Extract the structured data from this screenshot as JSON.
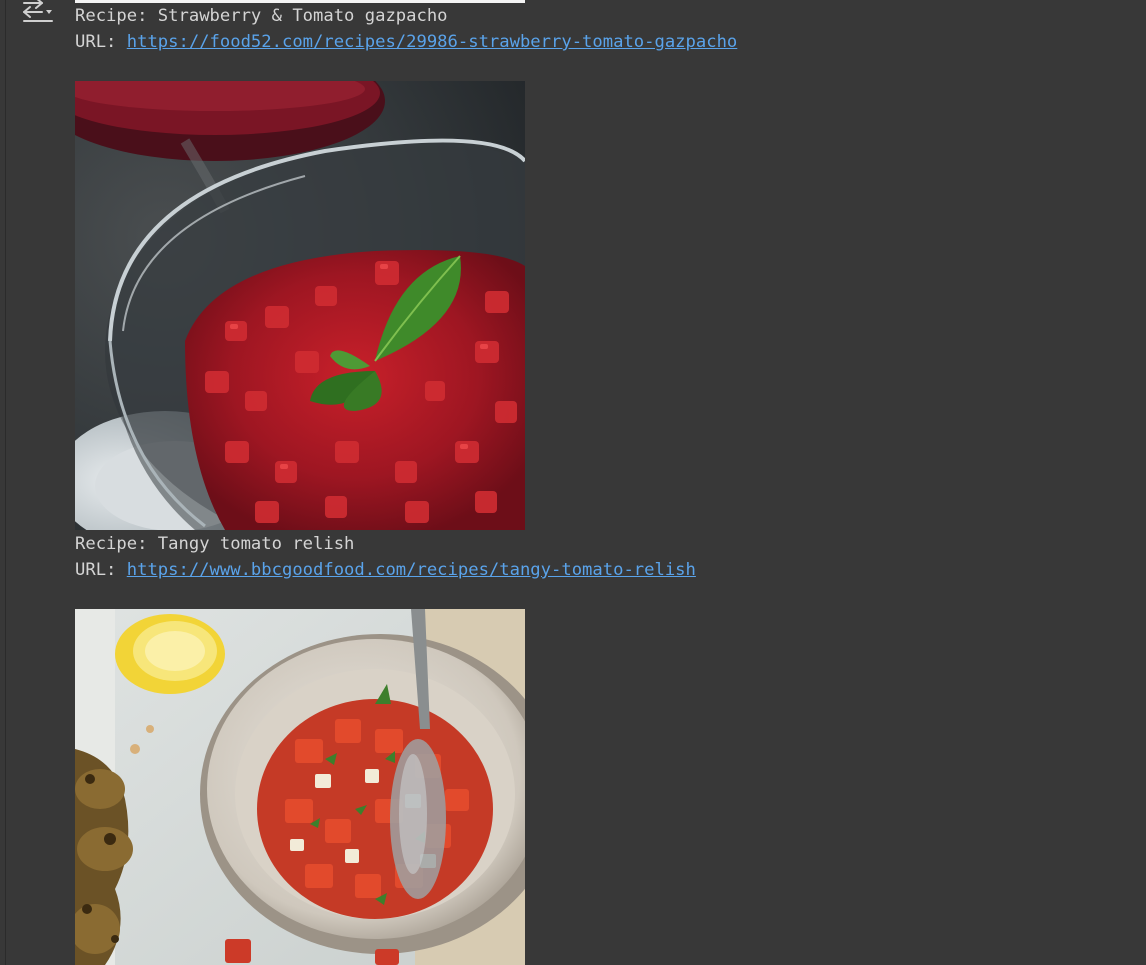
{
  "output": {
    "icon": "output-toggle-icon",
    "entries": [
      {
        "recipe_prefix": "Recipe: ",
        "recipe_name": "Strawberry & Tomato gazpacho",
        "url_prefix": "URL: ",
        "url": "https://food52.com/recipes/29986-strawberry-tomato-gazpacho"
      },
      {
        "recipe_prefix": "Recipe: ",
        "recipe_name": "Tangy tomato relish",
        "url_prefix": "URL: ",
        "url": "https://www.bbcgoodfood.com/recipes/tangy-tomato-relish"
      }
    ]
  },
  "colors": {
    "background": "#383838",
    "text": "#d4d4d4",
    "link": "#5aa3ea"
  }
}
